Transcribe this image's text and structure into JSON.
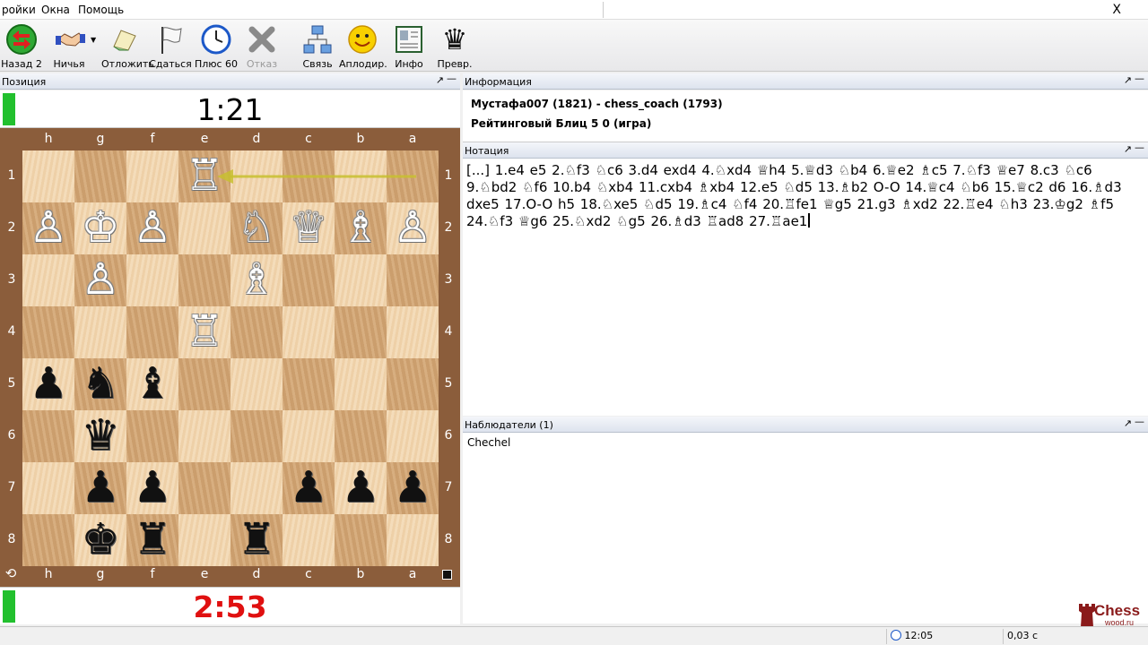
{
  "menu": {
    "items": [
      "ройки",
      "Окна",
      "Помощь"
    ],
    "close": "X"
  },
  "toolbar": {
    "buttons": [
      {
        "label": "Назад 2",
        "icon": "back-arrow-icon"
      },
      {
        "label": "Ничья",
        "icon": "handshake-icon"
      },
      {
        "label": "Отложить",
        "icon": "adjourn-icon"
      },
      {
        "label": "Сдаться",
        "icon": "white-flag-icon"
      },
      {
        "label": "Плюс 60",
        "icon": "clock-icon"
      },
      {
        "label": "Отказ",
        "icon": "decline-x-icon",
        "disabled": true
      },
      {
        "label": "Связь",
        "icon": "network-icon"
      },
      {
        "label": "Аплодир.",
        "icon": "smiley-icon"
      },
      {
        "label": "Инфо",
        "icon": "info-card-icon"
      },
      {
        "label": "Превр.",
        "icon": "queen-promote-icon"
      }
    ]
  },
  "panes": {
    "position": "Позиция",
    "info": "Информация",
    "notation": "Нотация",
    "observers": "Наблюдатели (1)"
  },
  "clocks": {
    "top": "1:21",
    "bottom": "2:53"
  },
  "board": {
    "files": [
      "h",
      "g",
      "f",
      "e",
      "d",
      "c",
      "b",
      "a"
    ],
    "ranks": [
      "1",
      "2",
      "3",
      "4",
      "5",
      "6",
      "7",
      "8"
    ],
    "pieces": [
      [
        "",
        "",
        "",
        "♖",
        "",
        "",
        "",
        ""
      ],
      [
        "♙",
        "♔",
        "♙",
        "",
        "♘",
        "♕",
        "♗",
        "♙"
      ],
      [
        "",
        "♙",
        "",
        "",
        "♗",
        "",
        "",
        ""
      ],
      [
        "",
        "",
        "",
        "♖",
        "",
        "",
        "",
        ""
      ],
      [
        "♟",
        "♞",
        "♝",
        "",
        "",
        "",
        "",
        ""
      ],
      [
        "",
        "♛",
        "",
        "",
        "",
        "",
        "",
        ""
      ],
      [
        "",
        "♟",
        "♟",
        "",
        "",
        "♟",
        "♟",
        "♟"
      ],
      [
        "",
        "♚",
        "♜",
        "",
        "♜",
        "",
        "",
        ""
      ]
    ],
    "last_move": {
      "from": "a1",
      "to": "e1"
    }
  },
  "info": {
    "line1": "Мустафа007 (1821) - chess_coach (1793)",
    "line2": "Рейтинговый Блиц 5 0  (игра)"
  },
  "notation": {
    "text": "[...] 1.e4 e5 2.♘f3 ♘c6 3.d4 exd4 4.♘xd4 ♕h4 5.♕d3 ♘b4 6.♕e2 ♗c5 7.♘f3 ♕e7 8.c3 ♘c6 9.♘bd2 ♘f6 10.b4 ♘xb4 11.cxb4 ♗xb4 12.e5 ♘d5 13.♗b2 O-O 14.♕c4 ♘b6 15.♕c2 d6 16.♗d3 dxe5 17.O-O h5 18.♘xe5 ♘d5 19.♗c4 ♘f4 20.♖fe1 ♕g5 21.g3 ♗xd2 22.♖e4 ♘h3 23.♔g2 ♗f5 24.♘f3 ♕g6 25.♘xd2 ♘g5 26.♗d3 ♖ad8 27.♖ae1"
  },
  "observers": [
    "Chechel"
  ],
  "status": {
    "time": "12:05",
    "lag": "0,03 с"
  },
  "logo": {
    "line1": "Chess",
    "line2": "wood.ru"
  }
}
